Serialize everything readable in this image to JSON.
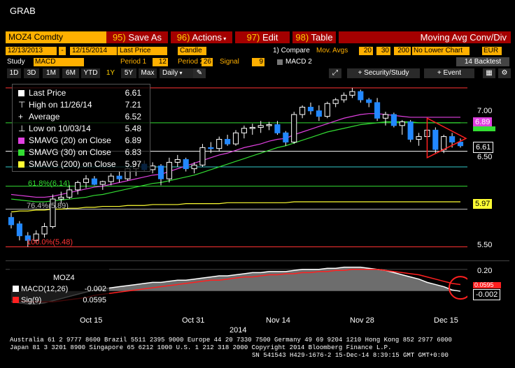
{
  "window": {
    "title": "GRAB"
  },
  "toolbar": {
    "security": "MOZ4 Comdty",
    "buttons": [
      {
        "num": "95)",
        "label": "Save As"
      },
      {
        "num": "96)",
        "label": "Actions"
      },
      {
        "num": "97)",
        "label": "Edit"
      },
      {
        "num": "98)",
        "label": "Table"
      }
    ],
    "study_title": "Moving Avg Conv/Div"
  },
  "settings": {
    "start_date": "12/13/2013",
    "dash": "-",
    "end_date": "12/15/2014",
    "field": "Last Price",
    "chart_type": "Candle",
    "compare_label": "1) Compare",
    "mov_avgs_label": "Mov. Avgs",
    "ma1": "20",
    "ma2": "30",
    "ma3": "200",
    "lower_chart": "No Lower Chart",
    "currency": "EUR"
  },
  "study_row": {
    "study_label": "Study",
    "study_value": "MACD",
    "period1_label": "Period 1",
    "period1_value": "12",
    "period2_label": "Period 2",
    "period2_value": "26",
    "signal_label": "Signal",
    "signal_value": "9",
    "macd2_label": "MACD 2",
    "backtest_label": "14 Backtest"
  },
  "tabs": {
    "ranges": [
      "1D",
      "3D",
      "1M",
      "6M",
      "YTD",
      "1Y",
      "5Y",
      "Max"
    ],
    "selected": "1Y",
    "frequency": "Daily",
    "security_study": "Security/Study",
    "event": "Event"
  },
  "legend": [
    {
      "label": "Last Price",
      "value": "6.61",
      "color": "#ffffff",
      "icon": "square"
    },
    {
      "label": "High on 11/26/14",
      "value": "7.21",
      "color": "#ffffff",
      "icon": "high-marker-icon"
    },
    {
      "label": "Average",
      "value": "6.52",
      "color": "#ffffff",
      "icon": "average-marker-icon"
    },
    {
      "label": "Low on 10/03/14",
      "value": "5.48",
      "color": "#ffffff",
      "icon": "low-marker-icon"
    },
    {
      "label": "SMAVG (20) on Close",
      "value": "6.89",
      "color": "#e040e0",
      "icon": "square"
    },
    {
      "label": "SMAVG (30) on Close",
      "value": "6.83",
      "color": "#33dd33",
      "icon": "square"
    },
    {
      "label": "SMAVG (200) on Close",
      "value": "5.97",
      "color": "#ffff33",
      "icon": "square"
    }
  ],
  "fib_labels": [
    "61.8%(6.14)",
    "76.4%(5.89)",
    "100.0%(5.48)"
  ],
  "price_axis": [
    "7.00",
    "6.50",
    "5.50"
  ],
  "price_tags": [
    {
      "text": "6.89",
      "bg": "#e040e0",
      "fg": "#ffffff"
    },
    {
      "text": "6.61",
      "bg": "#000000",
      "fg": "#ffffff"
    },
    {
      "text": "5.97",
      "bg": "#ffff33",
      "fg": "#000000"
    }
  ],
  "macd_panel": {
    "title": "MOZ4",
    "macd_label": "MACD(12,26)",
    "macd_value": "-0.002",
    "sig_label": "Sig(9)",
    "sig_value": "0.0595",
    "axis": [
      "0.20"
    ],
    "tag_value": "-0.002",
    "tag_red": "0.0595"
  },
  "x_axis": {
    "labels": [
      "Oct 15",
      "Oct 31",
      "Nov 14",
      "Nov 28",
      "Dec 15"
    ],
    "year": "2014"
  },
  "footer": {
    "line1": "Australia 61 2 9777 8600 Brazil 5511 2395 9000 Europe 44 20 7330 7500 Germany 49 69 9204 1210 Hong Kong 852 2977 6000",
    "line2": "Japan 81 3 3201 8900         Singapore 65 6212 1000         U.S. 1 212 318 2000         Copyright 2014 Bloomberg Finance L.P.",
    "line3": "SN 541543 H429-1676-2 15-Dec-14  8:39:15 GMT  GMT+0:00"
  },
  "colors": {
    "accent": "#ffb000",
    "toolbar_red": "#a40000",
    "up": "#ffffff",
    "down": "#2288ff"
  },
  "chart_data": {
    "type": "candlestick",
    "title": "MOZ4 Comdty",
    "y_range": [
      5.4,
      7.3
    ],
    "candles": [
      {
        "o": 5.8,
        "h": 5.85,
        "l": 5.68,
        "c": 5.72
      },
      {
        "o": 5.73,
        "h": 5.76,
        "l": 5.55,
        "c": 5.6
      },
      {
        "o": 5.6,
        "h": 5.64,
        "l": 5.48,
        "c": 5.55
      },
      {
        "o": 5.55,
        "h": 5.66,
        "l": 5.52,
        "c": 5.62
      },
      {
        "o": 5.62,
        "h": 5.74,
        "l": 5.58,
        "c": 5.7
      },
      {
        "o": 5.7,
        "h": 6.05,
        "l": 5.68,
        "c": 6.0
      },
      {
        "o": 6.0,
        "h": 6.08,
        "l": 5.95,
        "c": 6.02
      },
      {
        "o": 6.02,
        "h": 6.15,
        "l": 6.0,
        "c": 6.1
      },
      {
        "o": 6.1,
        "h": 6.2,
        "l": 6.05,
        "c": 6.18
      },
      {
        "o": 6.18,
        "h": 6.26,
        "l": 6.12,
        "c": 6.22
      },
      {
        "o": 6.22,
        "h": 6.25,
        "l": 6.15,
        "c": 6.16
      },
      {
        "o": 6.16,
        "h": 6.2,
        "l": 6.1,
        "c": 6.19
      },
      {
        "o": 6.19,
        "h": 6.28,
        "l": 6.15,
        "c": 6.25
      },
      {
        "o": 6.25,
        "h": 6.3,
        "l": 6.18,
        "c": 6.22
      },
      {
        "o": 6.22,
        "h": 6.36,
        "l": 6.2,
        "c": 6.33
      },
      {
        "o": 6.33,
        "h": 6.42,
        "l": 6.25,
        "c": 6.38
      },
      {
        "o": 6.38,
        "h": 6.42,
        "l": 6.3,
        "c": 6.32
      },
      {
        "o": 6.32,
        "h": 6.4,
        "l": 6.28,
        "c": 6.36
      },
      {
        "o": 6.36,
        "h": 6.38,
        "l": 6.15,
        "c": 6.22
      },
      {
        "o": 6.22,
        "h": 6.45,
        "l": 6.18,
        "c": 6.4
      },
      {
        "o": 6.4,
        "h": 6.48,
        "l": 6.35,
        "c": 6.43
      },
      {
        "o": 6.43,
        "h": 6.45,
        "l": 6.3,
        "c": 6.33
      },
      {
        "o": 6.33,
        "h": 6.4,
        "l": 6.28,
        "c": 6.37
      },
      {
        "o": 6.37,
        "h": 6.6,
        "l": 6.35,
        "c": 6.56
      },
      {
        "o": 6.56,
        "h": 6.62,
        "l": 6.5,
        "c": 6.55
      },
      {
        "o": 6.55,
        "h": 6.68,
        "l": 6.52,
        "c": 6.65
      },
      {
        "o": 6.65,
        "h": 6.7,
        "l": 6.58,
        "c": 6.6
      },
      {
        "o": 6.6,
        "h": 6.75,
        "l": 6.58,
        "c": 6.72
      },
      {
        "o": 6.72,
        "h": 6.8,
        "l": 6.66,
        "c": 6.77
      },
      {
        "o": 6.77,
        "h": 6.82,
        "l": 6.7,
        "c": 6.78
      },
      {
        "o": 6.78,
        "h": 6.85,
        "l": 6.72,
        "c": 6.8
      },
      {
        "o": 6.8,
        "h": 6.84,
        "l": 6.75,
        "c": 6.81
      },
      {
        "o": 6.81,
        "h": 6.85,
        "l": 6.7,
        "c": 6.72
      },
      {
        "o": 6.72,
        "h": 6.74,
        "l": 6.58,
        "c": 6.62
      },
      {
        "o": 6.62,
        "h": 6.95,
        "l": 6.6,
        "c": 6.92
      },
      {
        "o": 6.92,
        "h": 7.02,
        "l": 6.88,
        "c": 7.0
      },
      {
        "o": 7.0,
        "h": 7.05,
        "l": 6.92,
        "c": 6.96
      },
      {
        "o": 6.96,
        "h": 7.02,
        "l": 6.85,
        "c": 6.9
      },
      {
        "o": 6.9,
        "h": 7.06,
        "l": 6.88,
        "c": 7.04
      },
      {
        "o": 7.04,
        "h": 7.1,
        "l": 7.0,
        "c": 7.08
      },
      {
        "o": 7.08,
        "h": 7.16,
        "l": 7.05,
        "c": 7.13
      },
      {
        "o": 7.13,
        "h": 7.21,
        "l": 7.1,
        "c": 7.17
      },
      {
        "o": 7.17,
        "h": 7.19,
        "l": 7.05,
        "c": 7.08
      },
      {
        "o": 7.08,
        "h": 7.1,
        "l": 7.0,
        "c": 7.05
      },
      {
        "o": 7.05,
        "h": 7.1,
        "l": 6.85,
        "c": 6.88
      },
      {
        "o": 6.88,
        "h": 6.95,
        "l": 6.8,
        "c": 6.92
      },
      {
        "o": 6.92,
        "h": 6.94,
        "l": 6.78,
        "c": 6.8
      },
      {
        "o": 6.8,
        "h": 6.86,
        "l": 6.7,
        "c": 6.84
      },
      {
        "o": 6.84,
        "h": 6.86,
        "l": 6.62,
        "c": 6.65
      },
      {
        "o": 6.65,
        "h": 6.72,
        "l": 6.58,
        "c": 6.68
      },
      {
        "o": 6.68,
        "h": 6.78,
        "l": 6.62,
        "c": 6.75
      },
      {
        "o": 6.75,
        "h": 6.78,
        "l": 6.5,
        "c": 6.54
      },
      {
        "o": 6.54,
        "h": 6.7,
        "l": 6.5,
        "c": 6.68
      },
      {
        "o": 6.68,
        "h": 6.72,
        "l": 6.56,
        "c": 6.62
      },
      {
        "o": 6.62,
        "h": 6.66,
        "l": 6.56,
        "c": 6.58
      }
    ],
    "sma20": [
      6.05,
      6.04,
      6.03,
      6.02,
      6.02,
      6.03,
      6.05,
      6.07,
      6.09,
      6.11,
      6.13,
      6.14,
      6.16,
      6.18,
      6.2,
      6.22,
      6.24,
      6.26,
      6.27,
      6.3,
      6.33,
      6.36,
      6.39,
      6.42,
      6.45,
      6.48,
      6.5,
      6.53,
      6.56,
      6.58,
      6.6,
      6.63,
      6.65,
      6.66,
      6.7,
      6.73,
      6.76,
      6.79,
      6.82,
      6.85,
      6.88,
      6.9,
      6.92,
      6.93,
      6.93,
      6.92,
      6.91,
      6.9,
      6.89,
      6.89,
      6.89,
      6.89,
      6.89,
      6.89,
      6.89
    ],
    "sma30": [
      6.0,
      5.99,
      5.98,
      5.97,
      5.97,
      5.98,
      5.99,
      6.0,
      6.01,
      6.02,
      6.04,
      6.05,
      6.07,
      6.09,
      6.11,
      6.13,
      6.15,
      6.17,
      6.18,
      6.2,
      6.22,
      6.24,
      6.26,
      6.29,
      6.32,
      6.35,
      6.38,
      6.41,
      6.44,
      6.47,
      6.5,
      6.53,
      6.56,
      6.58,
      6.61,
      6.64,
      6.67,
      6.7,
      6.73,
      6.75,
      6.77,
      6.79,
      6.81,
      6.82,
      6.83,
      6.84,
      6.84,
      6.84,
      6.84,
      6.83,
      6.83,
      6.83,
      6.83,
      6.83,
      6.83
    ],
    "sma200": [
      5.86,
      5.87,
      5.87,
      5.88,
      5.88,
      5.89,
      5.89,
      5.9,
      5.9,
      5.91,
      5.91,
      5.92,
      5.92,
      5.92,
      5.93,
      5.93,
      5.93,
      5.94,
      5.94,
      5.94,
      5.94,
      5.95,
      5.95,
      5.95,
      5.95,
      5.95,
      5.96,
      5.96,
      5.96,
      5.96,
      5.96,
      5.96,
      5.96,
      5.96,
      5.97,
      5.97,
      5.97,
      5.97,
      5.97,
      5.97,
      5.97,
      5.97,
      5.97,
      5.97,
      5.97,
      5.97,
      5.97,
      5.97,
      5.97,
      5.97,
      5.97,
      5.97,
      5.97,
      5.97,
      5.97
    ],
    "hlines": [
      {
        "value": 7.21,
        "color": "#ff3333"
      },
      {
        "value": 6.52,
        "color": "#ffffff"
      },
      {
        "value": 6.83,
        "color": "#33dd33"
      },
      {
        "value": 6.35,
        "color": "#33cccc"
      },
      {
        "value": 6.14,
        "color": "#33dd33"
      },
      {
        "value": 5.89,
        "color": "#bbbbbb"
      },
      {
        "value": 5.48,
        "color": "#ff3333"
      }
    ],
    "macd": [
      -0.1,
      -0.11,
      -0.12,
      -0.12,
      -0.11,
      -0.09,
      -0.07,
      -0.05,
      -0.03,
      -0.01,
      0.01,
      0.02,
      0.03,
      0.04,
      0.05,
      0.06,
      0.07,
      0.08,
      0.08,
      0.09,
      0.1,
      0.1,
      0.11,
      0.12,
      0.13,
      0.14,
      0.14,
      0.15,
      0.16,
      0.17,
      0.17,
      0.18,
      0.18,
      0.18,
      0.19,
      0.2,
      0.2,
      0.2,
      0.21,
      0.21,
      0.22,
      0.22,
      0.22,
      0.21,
      0.2,
      0.19,
      0.17,
      0.15,
      0.13,
      0.11,
      0.08,
      0.06,
      0.04,
      0.01,
      -0.002
    ],
    "signal": [
      -0.08,
      -0.09,
      -0.1,
      -0.1,
      -0.1,
      -0.1,
      -0.09,
      -0.08,
      -0.07,
      -0.06,
      -0.04,
      -0.03,
      -0.02,
      -0.01,
      0.0,
      0.01,
      0.02,
      0.03,
      0.04,
      0.05,
      0.06,
      0.07,
      0.08,
      0.09,
      0.1,
      0.1,
      0.11,
      0.12,
      0.13,
      0.13,
      0.14,
      0.15,
      0.15,
      0.16,
      0.16,
      0.17,
      0.17,
      0.18,
      0.18,
      0.19,
      0.19,
      0.2,
      0.2,
      0.2,
      0.2,
      0.19,
      0.18,
      0.17,
      0.16,
      0.15,
      0.13,
      0.11,
      0.09,
      0.07,
      0.0595
    ],
    "macd_range": [
      -0.15,
      0.25
    ]
  }
}
